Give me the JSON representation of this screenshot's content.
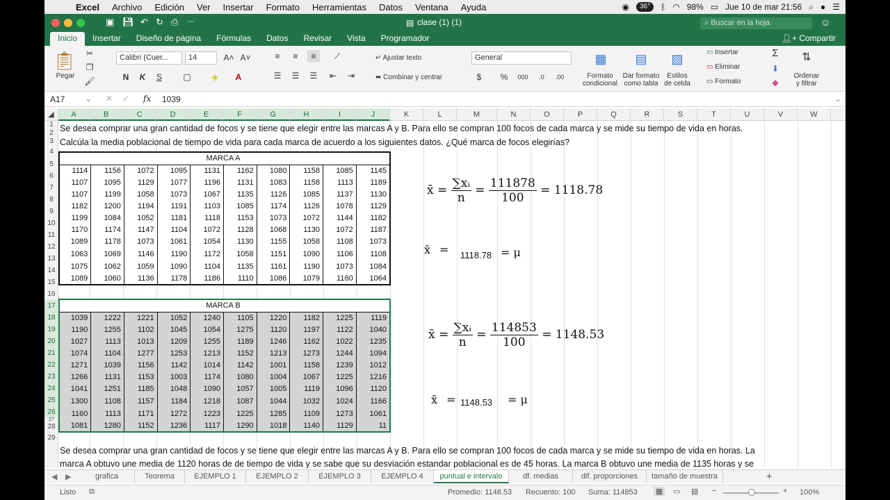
{
  "menubar": {
    "app": "Excel",
    "items": [
      "Archivo",
      "Edición",
      "Ver",
      "Insertar",
      "Formato",
      "Herramientas",
      "Datos",
      "Ventana",
      "Ayuda"
    ],
    "temp": "36°",
    "battery": "98%",
    "clock": "Jue 10 de mar  21:56"
  },
  "window": {
    "title": "clase (1) (1)",
    "search_placeholder": "Buscar en la hoja",
    "share": "Compartir"
  },
  "ribbon_tabs": [
    "Inicio",
    "Insertar",
    "Diseño de página",
    "Fórmulas",
    "Datos",
    "Revisar",
    "Vista",
    "Programador"
  ],
  "ribbon": {
    "paste": "Pegar",
    "font": "Calibri (Cuer...",
    "font_size": "14",
    "bold": "N",
    "italic": "K",
    "underline": "S",
    "wrap": "Ajustar texto",
    "merge": "Combinar y centrar",
    "number_format": "General",
    "cond_format_1": "Formato",
    "cond_format_2": "condicional",
    "table_format_1": "Dar formato",
    "table_format_2": "como tabla",
    "cell_styles_1": "Estilos",
    "cell_styles_2": "de celda",
    "insert": "Insertar",
    "delete": "Eliminar",
    "format": "Formato",
    "sort_1": "Ordenar",
    "sort_2": "y filtrar",
    "percent": "%",
    "thousands": "000",
    "currency": "$"
  },
  "formula_bar": {
    "cell_ref": "A17",
    "fx": "fx",
    "value": "1039"
  },
  "columns": [
    "A",
    "B",
    "C",
    "D",
    "E",
    "F",
    "G",
    "H",
    "I",
    "J",
    "K",
    "L",
    "M",
    "N",
    "O",
    "P",
    "Q",
    "R",
    "S",
    "T",
    "U",
    "V",
    "W"
  ],
  "rows": [
    "1",
    "2",
    "3",
    "4",
    "5",
    "6",
    "7",
    "8",
    "9",
    "10",
    "11",
    "12",
    "13",
    "14",
    "15",
    "16",
    "17",
    "18",
    "19",
    "20",
    "21",
    "22",
    "23",
    "24",
    "25",
    "26",
    "27",
    "28",
    "29"
  ],
  "texts": {
    "line1": "Se desea comprar una gran cantidad de focos y se tiene que elegir entre las marcas A y B. Para ello se compran 100 focos de cada marca y se mide su tiempo de vida en horas.",
    "line3": "Calcúla la media poblacional de tiempo de vida para cada marca de acuerdo a los siguientes datos. ¿Qué marca de focos elegirías?",
    "line28": "Se desea comprar una gran cantidad de focos y se tiene que elegir entre las marcas A y B. Para ello se compran 100 focos de cada marca y se mide su tiempo de vida en horas. La",
    "line29": "marca A obtuvo une media de 1120 horas de de tiempo de vida y se sabe que su desviación estandar poblacional es de 45 horas. La marca B obtuvo une media de 1135 horas y se"
  },
  "marca_a": {
    "title": "MARCA A",
    "rows": [
      [
        1114,
        1156,
        1072,
        1095,
        1131,
        1162,
        1080,
        1158,
        1085,
        1145
      ],
      [
        1107,
        1095,
        1129,
        1077,
        1196,
        1131,
        1083,
        1158,
        1113,
        1189
      ],
      [
        1107,
        1199,
        1058,
        1073,
        1067,
        1135,
        1126,
        1085,
        1137,
        1130
      ],
      [
        1182,
        1200,
        1194,
        1191,
        1103,
        1085,
        1174,
        1126,
        1078,
        1129
      ],
      [
        1199,
        1084,
        1052,
        1181,
        1118,
        1153,
        1073,
        1072,
        1144,
        1182
      ],
      [
        1170,
        1174,
        1147,
        1104,
        1072,
        1128,
        1068,
        1130,
        1072,
        1187
      ],
      [
        1089,
        1178,
        1073,
        1061,
        1054,
        1130,
        1155,
        1058,
        1108,
        1073
      ],
      [
        1063,
        1069,
        1146,
        1190,
        1172,
        1058,
        1151,
        1090,
        1106,
        1108
      ],
      [
        1075,
        1062,
        1059,
        1090,
        1104,
        1135,
        1161,
        1190,
        1073,
        1084
      ],
      [
        1089,
        1060,
        1136,
        1178,
        1186,
        1110,
        1086,
        1079,
        1160,
        1064
      ]
    ]
  },
  "marca_b": {
    "title": "MARCA B",
    "rows": [
      [
        1039,
        1222,
        1221,
        1052,
        1240,
        1105,
        1220,
        1182,
        1225,
        1119
      ],
      [
        1190,
        1255,
        1102,
        1045,
        1054,
        1275,
        1120,
        1197,
        1122,
        1040
      ],
      [
        1027,
        1113,
        1013,
        1209,
        1255,
        1189,
        1246,
        1162,
        1022,
        1235
      ],
      [
        1074,
        1104,
        1277,
        1253,
        1213,
        1152,
        1213,
        1273,
        1244,
        1094
      ],
      [
        1271,
        1039,
        1156,
        1142,
        1014,
        1142,
        1001,
        1158,
        1239,
        1012
      ],
      [
        1266,
        1131,
        1153,
        1003,
        1174,
        1080,
        1004,
        1067,
        1225,
        1216
      ],
      [
        1041,
        1251,
        1185,
        1048,
        1090,
        1057,
        1005,
        1119,
        1096,
        1120
      ],
      [
        1300,
        1108,
        1157,
        1184,
        1218,
        1087,
        1044,
        1032,
        1024,
        1166
      ],
      [
        1160,
        1113,
        1171,
        1272,
        1223,
        1225,
        1285,
        1109,
        1273,
        1061
      ],
      [
        1081,
        1280,
        1152,
        1236,
        1117,
        1290,
        1018,
        1140,
        1129,
        "11"
      ]
    ]
  },
  "formulas": {
    "a_sum": "111878",
    "a_n": "100",
    "a_result": "= 1118.78",
    "a_mean": "1118.78",
    "b_sum": "114853",
    "b_n": "100",
    "b_result": "= 1148.53",
    "b_mean": "1148.53",
    "xbar": "x̄",
    "eq": "=",
    "sigma_x": "∑xᵢ",
    "n": "n",
    "mu": "= μ"
  },
  "sheet_tabs": [
    "grafica",
    "Teorema",
    "EJEMPLO 1",
    "EJEMPLO 2",
    "EJEMPLO 3",
    "EJEMPLO 4",
    "puntual e intervalo",
    "df. medias",
    "dif. proporciones",
    "tamaño de muestra"
  ],
  "status": {
    "mode": "Listo",
    "average": "Promedio: 1148.53",
    "count": "Recuento: 100",
    "sum": "Suma: 114853",
    "zoom": "100%"
  },
  "colors": {
    "excel_green": "#227447",
    "selection_fill": "#d4d4d4"
  }
}
